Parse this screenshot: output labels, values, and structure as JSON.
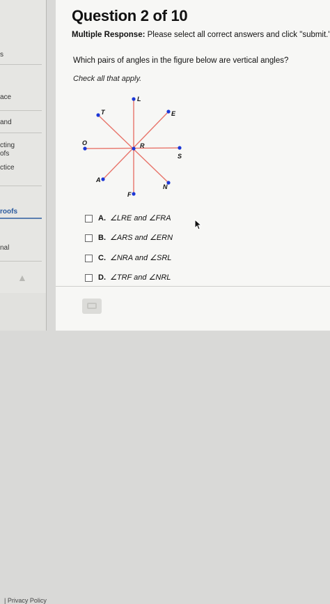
{
  "sidebar": {
    "items": [
      {
        "label": "s"
      },
      {
        "label": "ace"
      },
      {
        "label": "and"
      },
      {
        "label": "cting"
      },
      {
        "label": "ofs"
      },
      {
        "label": "ctice"
      },
      {
        "label": "roofs"
      },
      {
        "label": "nal"
      }
    ],
    "privacy": "| Privacy Policy"
  },
  "question": {
    "title": "Question 2 of 10",
    "type_label": "Multiple Response:",
    "instruction": "Please select all correct answers and click \"submit.\"",
    "prompt": "Which pairs of angles in the figure below are vertical angles?",
    "check_all": "Check all that apply."
  },
  "figure": {
    "center_label": "R",
    "point_labels": {
      "L": "L",
      "E": "E",
      "S": "S",
      "N": "N",
      "F": "F",
      "A": "A",
      "O": "O",
      "T": "T"
    },
    "colors": {
      "line": "#e8746a",
      "point": "#1c37d6",
      "label": "#111111"
    }
  },
  "options": [
    {
      "letter": "A.",
      "text": "∠LRE and ∠FRA"
    },
    {
      "letter": "B.",
      "text": "∠ARS and ∠ERN"
    },
    {
      "letter": "C.",
      "text": "∠NRA and ∠SRL"
    },
    {
      "letter": "D.",
      "text": "∠TRF and ∠NRL"
    }
  ]
}
